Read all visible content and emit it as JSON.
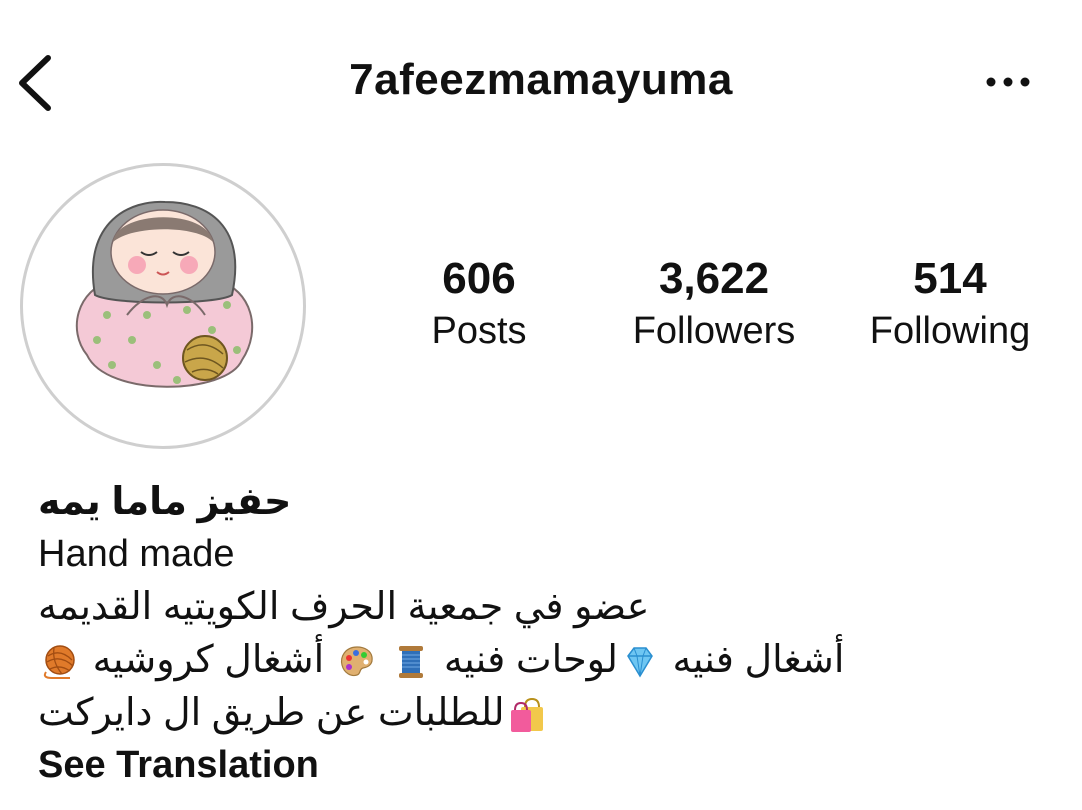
{
  "header": {
    "username": "7afeezmamayuma",
    "back_icon": "chevron-left-icon",
    "more_icon": "ellipsis-horizontal-icon"
  },
  "profile": {
    "avatar_icon": "matryoshka-doll-illustration"
  },
  "stats": {
    "posts": {
      "value": "606",
      "label": "Posts"
    },
    "followers": {
      "value": "3,622",
      "label": "Followers"
    },
    "following": {
      "value": "514",
      "label": "Following"
    }
  },
  "bio": {
    "name": "حفيز ماما يمه",
    "line1": "Hand made",
    "line2": "عضو في جمعية الحرف الكويتيه القديمه",
    "line3_part1": "أشغال فنيه",
    "line3_part2": "لوحات فنيه",
    "line3_part3": "أشغال كروشيه",
    "line4": "للطلبات عن طريق ال دايركت",
    "emoji_icons": [
      "gem-icon",
      "thread-spool-icon",
      "artist-palette-icon",
      "yarn-ball-icon",
      "shopping-bags-icon"
    ],
    "see_translation": "See Translation"
  },
  "colors": {
    "text": "#111111",
    "avatar_ring": "#cfcfcf",
    "background": "#ffffff"
  }
}
